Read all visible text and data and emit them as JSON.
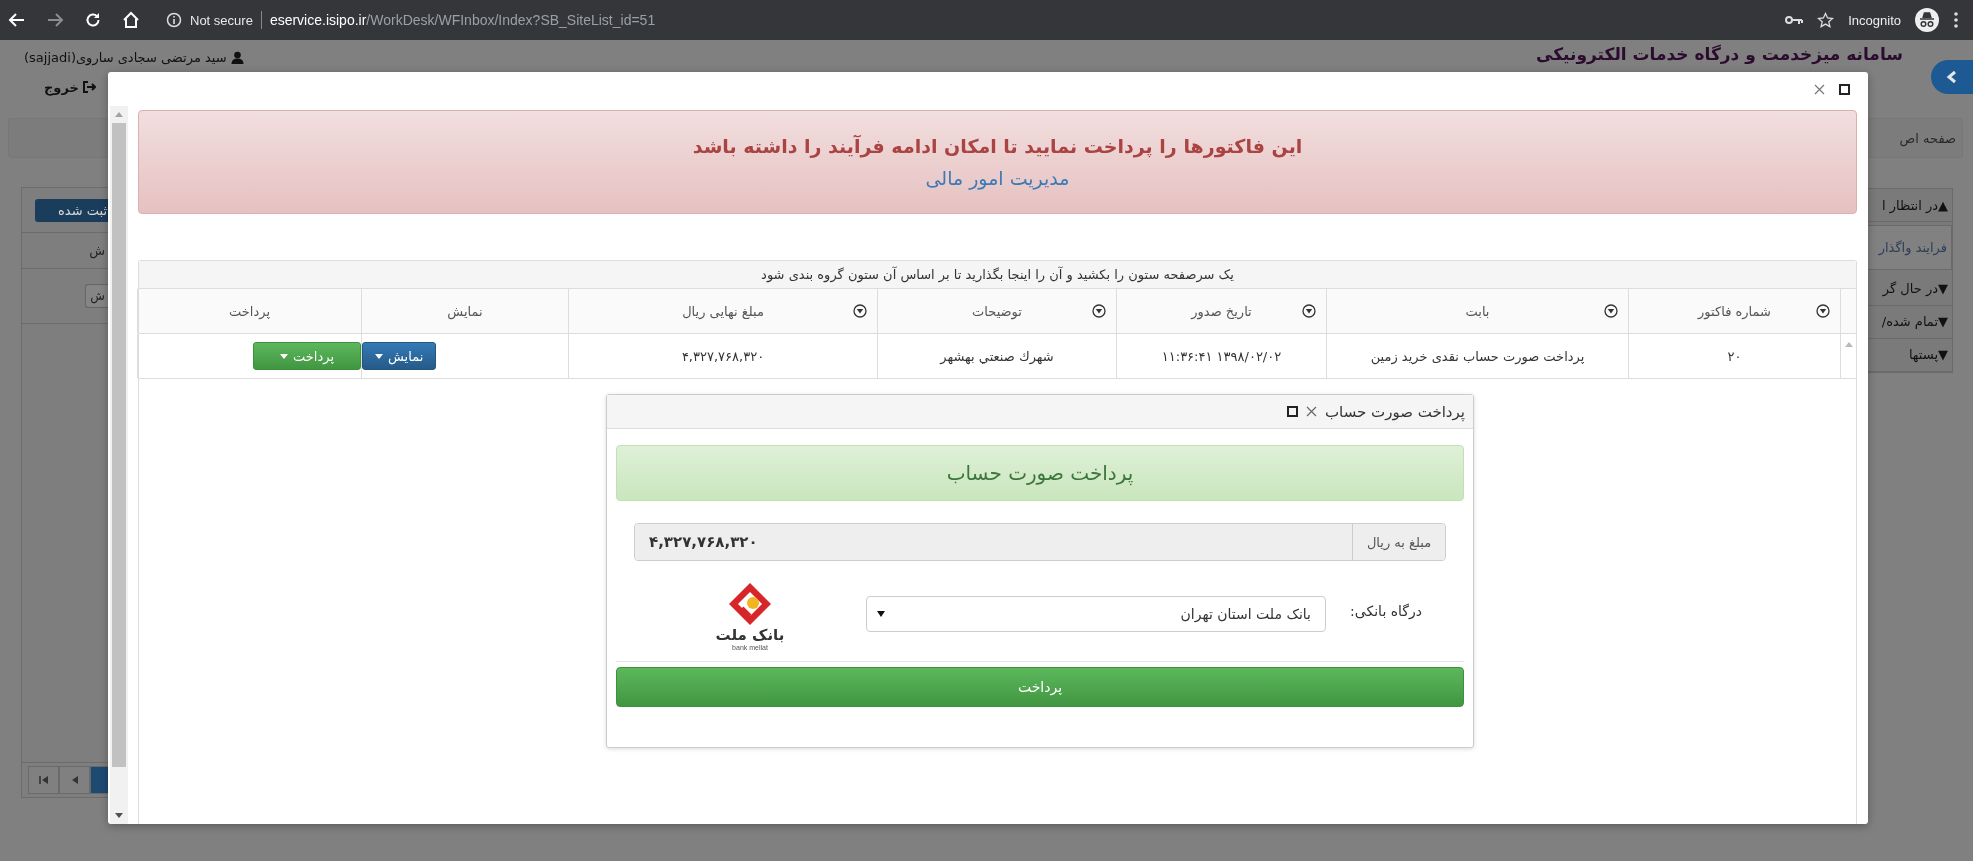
{
  "browser": {
    "security_label": "Not secure",
    "url_host": "eservice.isipo.ir",
    "url_path": "/WorkDesk/WFInbox/Index?SB_SiteList_id=51",
    "profile": "Incognito"
  },
  "page": {
    "user": "سید مرتضی سجادی ساروی(sajjadi)",
    "site_title": "سامانه میزخدمت و درگاه خدمات الکترونیکی",
    "logout": "خروج",
    "breadcrumb": "صفحه اص",
    "left_panel": {
      "tab_button": "ثبت شده",
      "column_header": "ش",
      "row_button": "ش"
    },
    "sidebar_items": [
      {
        "kind": "group",
        "label": "▲در انتظار ا"
      },
      {
        "kind": "link",
        "label": "فرایند واگذار"
      },
      {
        "kind": "group",
        "label": "▼در حال گر"
      },
      {
        "kind": "group",
        "label": "▼تمام شده/"
      },
      {
        "kind": "group",
        "label": "▼پستها"
      }
    ]
  },
  "modal": {
    "alert": {
      "message": "این فاکتورها را پرداخت نمایید تا امکان ادامه فرآیند را داشته باشد",
      "signature": "مدیریت امور مالی"
    },
    "grid": {
      "group_hint": "یک سرصفحه ستون را بکشید و آن را اینجا بگذارید تا بر اساس آن ستون گروه بندی شود",
      "columns": [
        {
          "label": "شماره فاکتور",
          "filterable": true
        },
        {
          "label": "بابت",
          "filterable": true
        },
        {
          "label": "تاریخ صدور",
          "filterable": true
        },
        {
          "label": "توضیحات",
          "filterable": true
        },
        {
          "label": "مبلغ نهایی ریال",
          "filterable": true
        },
        {
          "label": "نمایش",
          "filterable": false
        },
        {
          "label": "پرداخت",
          "filterable": false
        }
      ],
      "rows": [
        {
          "cells": [
            "۲۰",
            "پرداخت صورت حساب نقدی خرید زمین",
            "۱۳۹۸/۰۲/۰۲ ۱۱:۳۶:۴۱",
            "شهرك صنعتي بهشهر",
            "۴,۳۲۷,۷۶۸,۳۲۰"
          ],
          "show_button": "نمایش",
          "pay_button": "پرداخت"
        }
      ]
    },
    "dialog": {
      "title": "پرداخت صورت حساب",
      "heading": "پرداخت صورت حساب",
      "amount_label": "مبلغ به ریال",
      "amount_value": "۴,۳۲۷,۷۶۸,۳۲۰",
      "gateway_label": "درگاه بانکی:",
      "gateway_value": "بانک ملت استان تهران",
      "logo_name": "بانک ملت",
      "logo_latin": "bank mellat",
      "pay_button": "پرداخت"
    }
  }
}
